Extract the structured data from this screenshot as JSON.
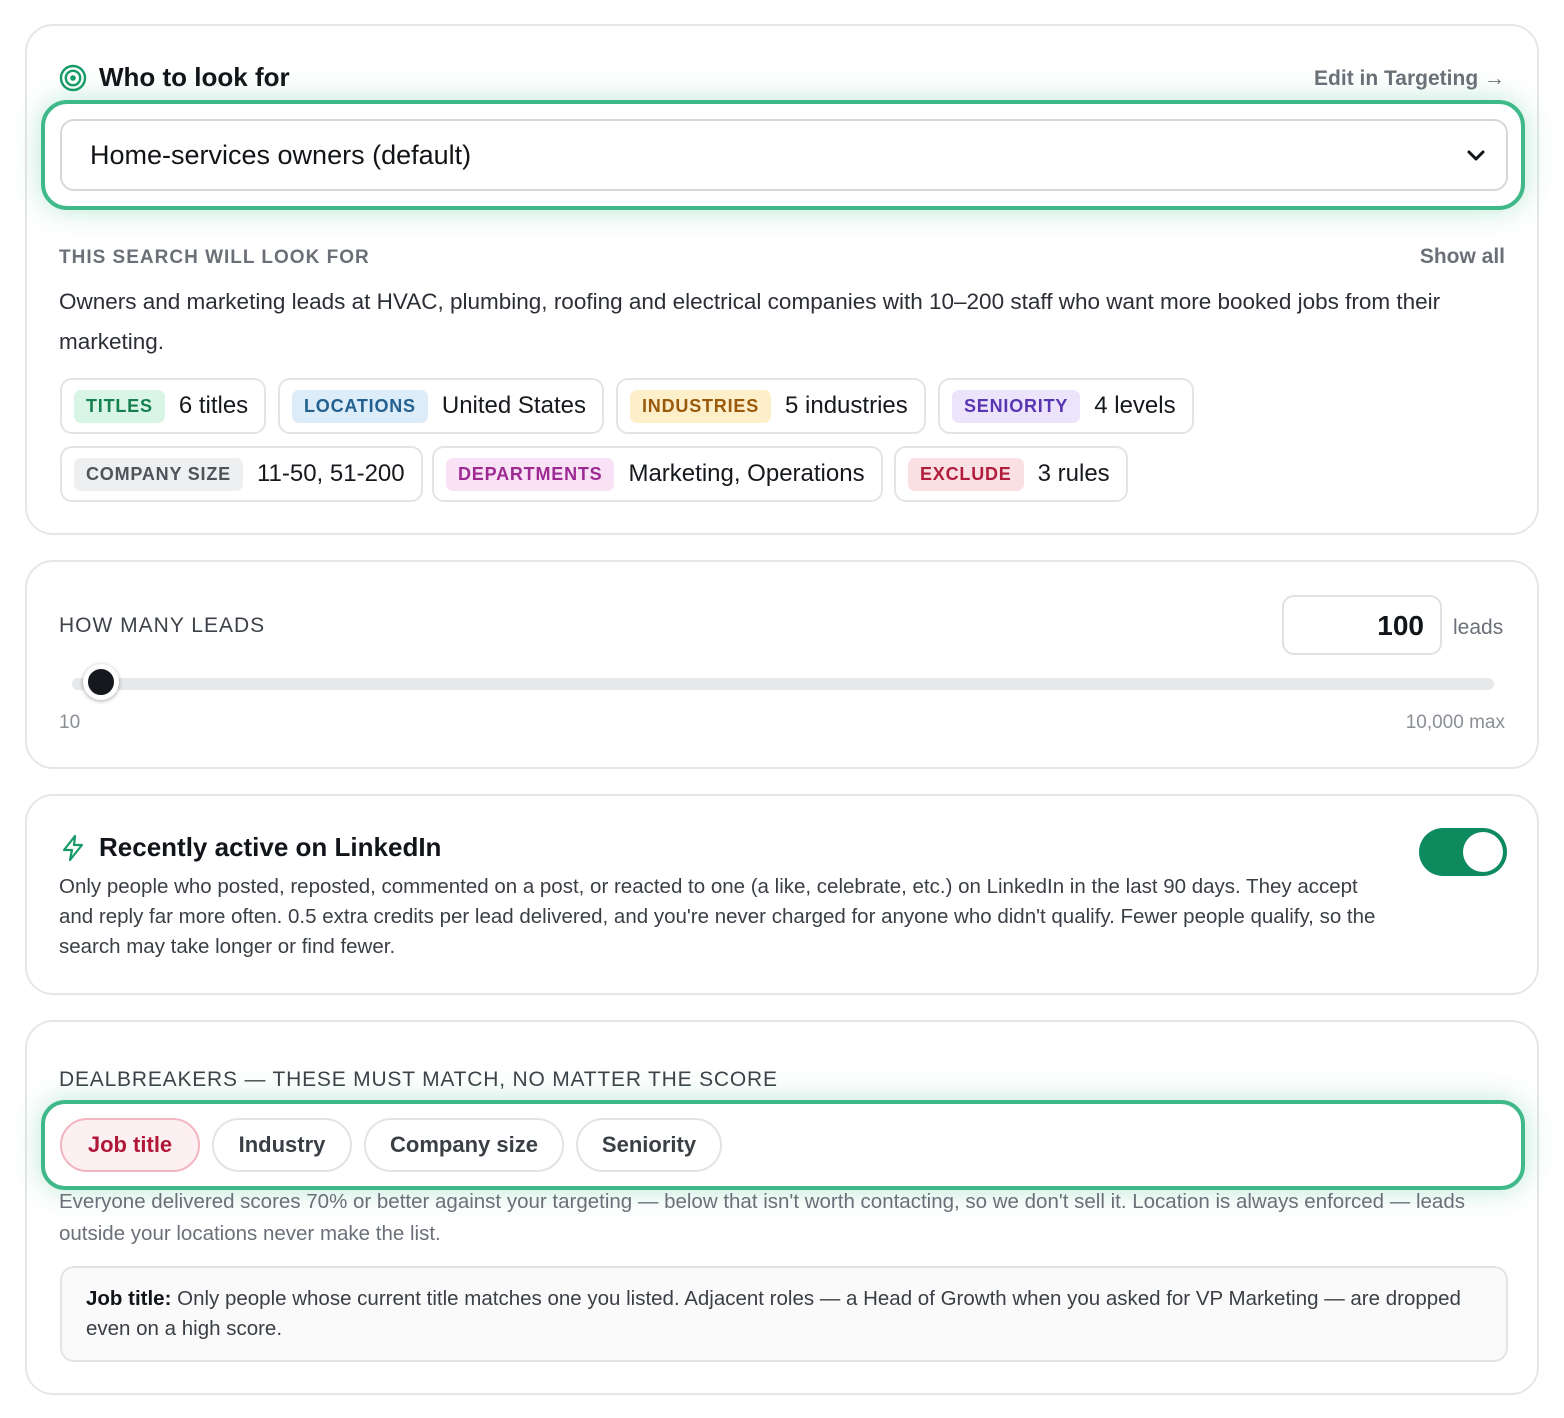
{
  "targeting": {
    "title": "Who to look for",
    "edit_link": "Edit in Targeting →",
    "preset": "Home-services owners (default)",
    "search_eyebrow": "THIS SEARCH WILL LOOK FOR",
    "show_all": "Show all",
    "summary": "Owners and marketing leads at HVAC, plumbing, roofing and electrical companies with 10–200 staff who want more booked jobs from their marketing.",
    "chips": {
      "titles": {
        "tag": "TITLES",
        "value": "6 titles"
      },
      "locations": {
        "tag": "LOCATIONS",
        "value": "United States"
      },
      "industries": {
        "tag": "INDUSTRIES",
        "value": "5 industries"
      },
      "seniority": {
        "tag": "SENIORITY",
        "value": "4 levels"
      },
      "company_size": {
        "tag": "COMPANY SIZE",
        "value": "11-50, 51-200"
      },
      "departments": {
        "tag": "DEPARTMENTS",
        "value": "Marketing, Operations"
      },
      "exclude": {
        "tag": "EXCLUDE",
        "value": "3 rules"
      }
    }
  },
  "leads": {
    "eyebrow": "HOW MANY LEADS",
    "value": "100",
    "unit": "leads",
    "min_label": "10",
    "max_label": "10,000 max",
    "slider_fraction": 0.009
  },
  "linkedin": {
    "title": "Recently active on LinkedIn",
    "description": "Only people who posted, reposted, commented on a post, or reacted to one (a like, celebrate, etc.) on LinkedIn in the last 90 days. They accept and reply far more often. 0.5 extra credits per lead delivered, and you're never charged for anyone who didn't qualify. Fewer people qualify, so the search may take longer or find fewer.",
    "toggle_on": true
  },
  "dealbreakers": {
    "eyebrow": "DEALBREAKERS — THESE MUST MATCH, NO MATTER THE SCORE",
    "pills": [
      "Job title",
      "Industry",
      "Company size",
      "Seniority"
    ],
    "active": "Job title",
    "description": "Everyone delivered scores 70% or better against your targeting — below that isn't worth contacting, so we don't sell it. Location is always enforced — leads outside your locations never make the list.",
    "info_label": "Job title:",
    "info_text": " Only people whose current title matches one you listed. Adjacent roles — a Head of Growth when you asked for VP Marketing — are dropped even on a high score."
  },
  "colors": {
    "accent_green": "#3fb98a",
    "toggle_green": "#0e8a5f",
    "active_red": "#b0183a"
  }
}
